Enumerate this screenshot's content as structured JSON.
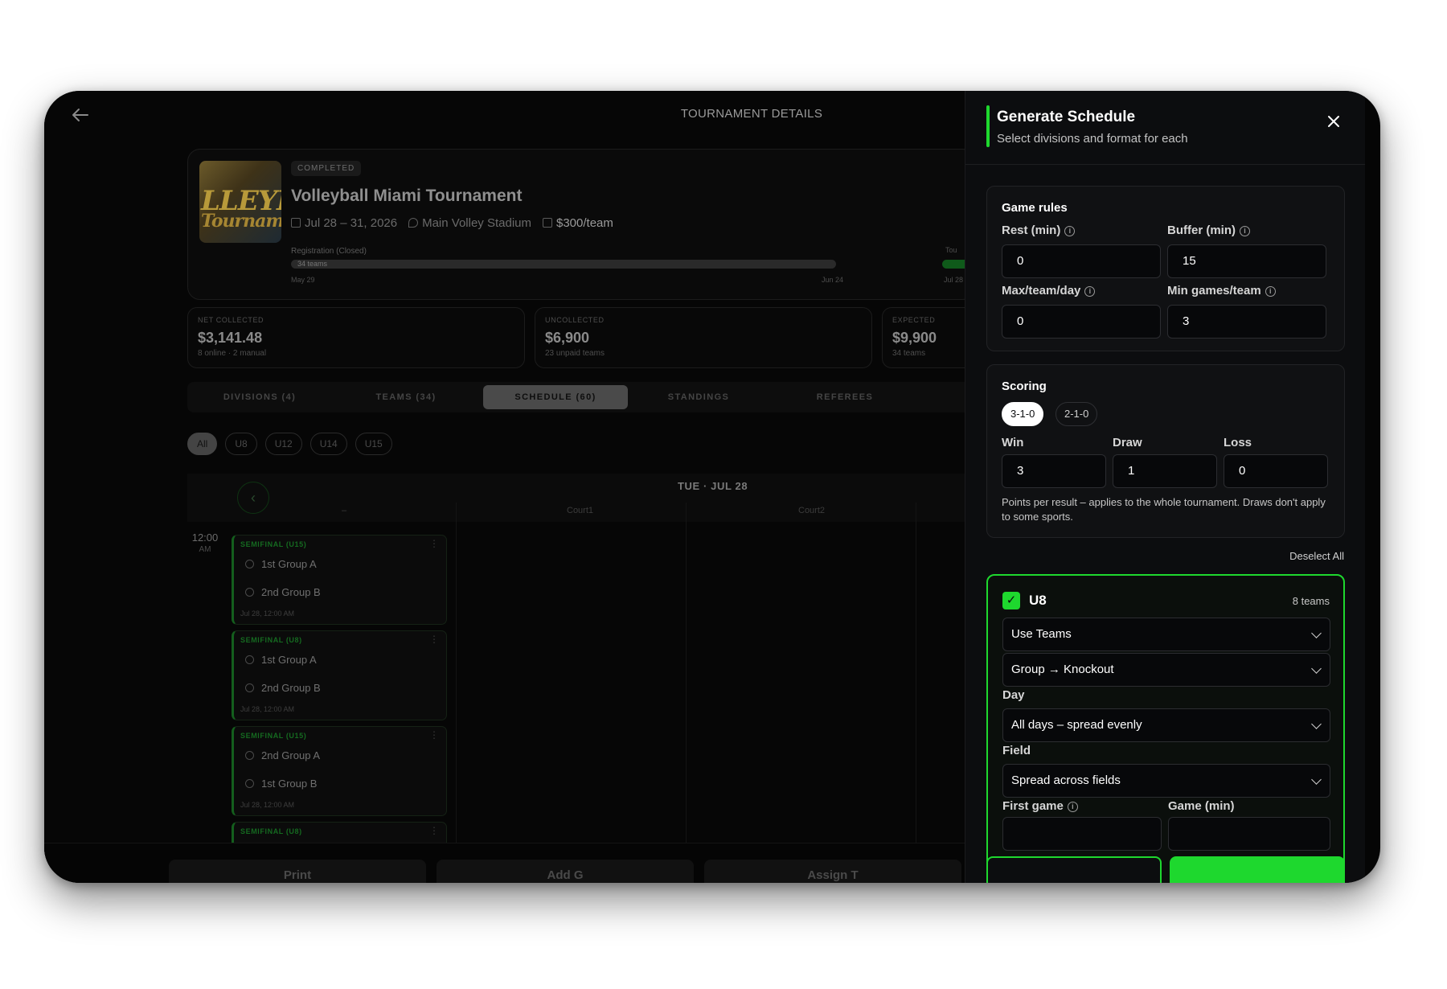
{
  "header": {
    "title": "TOURNAMENT DETAILS"
  },
  "tournament": {
    "status": "COMPLETED",
    "name": "Volleyball Miami Tournament",
    "dates": "Jul 28 – 31, 2026",
    "venue": "Main Volley Stadium",
    "price": "$300/team",
    "thumb_text_1": "LLEYBI",
    "thumb_text_2": "Tourname",
    "registration_label": "Registration (Closed)",
    "teams_label": "34 teams",
    "tournament_label": "Tou",
    "date_start": "May 29",
    "date_mid": "Jun 24",
    "date_end": "Jul 28"
  },
  "stats": [
    {
      "label": "NET COLLECTED",
      "value": "$3,141.48",
      "sub": "8 online · 2 manual"
    },
    {
      "label": "UNCOLLECTED",
      "value": "$6,900",
      "sub": "23 unpaid teams"
    },
    {
      "label": "EXPECTED",
      "value": "$9,900",
      "sub": "34 teams"
    }
  ],
  "tabs": [
    {
      "label": "DIVISIONS (4)"
    },
    {
      "label": "TEAMS (34)"
    },
    {
      "label": "SCHEDULE (60)"
    },
    {
      "label": "STANDINGS"
    },
    {
      "label": "REFEREES"
    }
  ],
  "division_chips": [
    "All",
    "U8",
    "U12",
    "U14",
    "U15"
  ],
  "calendar": {
    "date": "TUE · JUL 28",
    "columns": [
      "–",
      "Court1",
      "Court2"
    ],
    "time": "12:00",
    "time_period": "AM"
  },
  "matches": [
    {
      "title": "SEMIFINAL (U15)",
      "team1": "1st Group A",
      "team2": "2nd Group B",
      "time": "Jul 28, 12:00 AM"
    },
    {
      "title": "SEMIFINAL (U8)",
      "team1": "1st Group A",
      "team2": "2nd Group B",
      "time": "Jul 28, 12:00 AM"
    },
    {
      "title": "SEMIFINAL (U15)",
      "team1": "2nd Group A",
      "team2": "1st Group B",
      "time": "Jul 28, 12:00 AM"
    },
    {
      "title": "SEMIFINAL (U8)",
      "team1": "",
      "team2": "",
      "time": ""
    }
  ],
  "bottom_actions": [
    "Print",
    "Add G",
    "Assign T"
  ],
  "panel": {
    "title": "Generate Schedule",
    "subtitle": "Select divisions and format for each",
    "game_rules": {
      "title": "Game rules",
      "rest_label": "Rest (min)",
      "rest_value": "0",
      "buffer_label": "Buffer (min)",
      "buffer_value": "15",
      "max_label": "Max/team/day",
      "max_value": "0",
      "min_label": "Min games/team",
      "min_value": "3"
    },
    "scoring": {
      "title": "Scoring",
      "presets": [
        "3-1-0",
        "2-1-0"
      ],
      "win_label": "Win",
      "win_value": "3",
      "draw_label": "Draw",
      "draw_value": "1",
      "loss_label": "Loss",
      "loss_value": "0",
      "note": "Points per result – applies to the whole tournament. Draws don't apply to some sports."
    },
    "deselect_all": "Deselect All",
    "division": {
      "name": "U8",
      "teams": "8 teams",
      "team_source": "Use Teams",
      "format": "Group → Knockout",
      "day_label": "Day",
      "day_value": "All days – spread evenly",
      "field_label": "Field",
      "field_value": "Spread across fields",
      "first_game_label": "First game",
      "game_min_label": "Game (min)"
    }
  },
  "colors": {
    "accent": "#1ed82e",
    "background": "#050505",
    "panel": "#0c0d0f"
  }
}
